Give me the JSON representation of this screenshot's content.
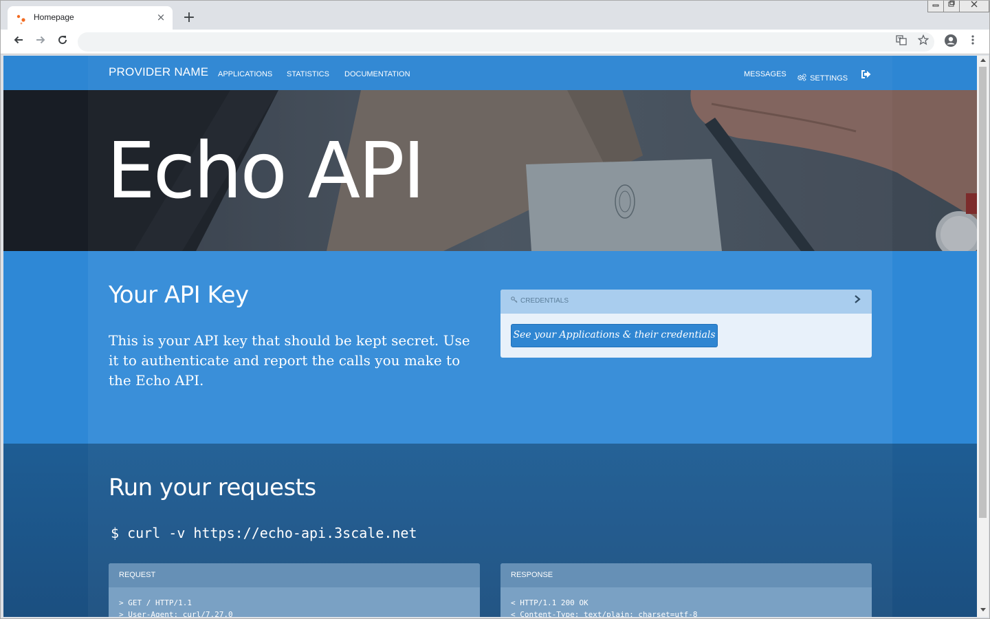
{
  "browser": {
    "tab_title": "Homepage",
    "tab_close": "×",
    "new_tab": "+",
    "url": "",
    "window_controls": [
      "▭",
      "⧉",
      "✕"
    ]
  },
  "nav": {
    "brand": "PROVIDER NAME",
    "links": [
      "APPLICATIONS",
      "STATISTICS",
      "DOCUMENTATION"
    ],
    "messages": "MESSAGES",
    "settings": "SETTINGS"
  },
  "hero": {
    "title": "Echo API"
  },
  "api_key": {
    "heading": "Your API Key",
    "description": "This is your API key that should be kept secret. Use it to authenticate and report the calls you make to the Echo API.",
    "panel_label": "CREDENTIALS",
    "button_label": "See your Applications & their credentials"
  },
  "requests": {
    "heading": "Run your requests",
    "command": "$ curl -v https://echo-api.3scale.net",
    "request_label": "REQUEST",
    "request_lines": [
      "> GET / HTTP/1.1",
      "> User-Agent: curl/7.27.0"
    ],
    "response_label": "RESPONSE",
    "response_lines": [
      "< HTTP/1.1 200 OK",
      "< Content-Type: text/plain; charset=utf-8"
    ]
  },
  "colors": {
    "brand_blue": "#2d86d3",
    "dark_blue": "#1e5d94",
    "favicon_orange": "#f26b21"
  }
}
